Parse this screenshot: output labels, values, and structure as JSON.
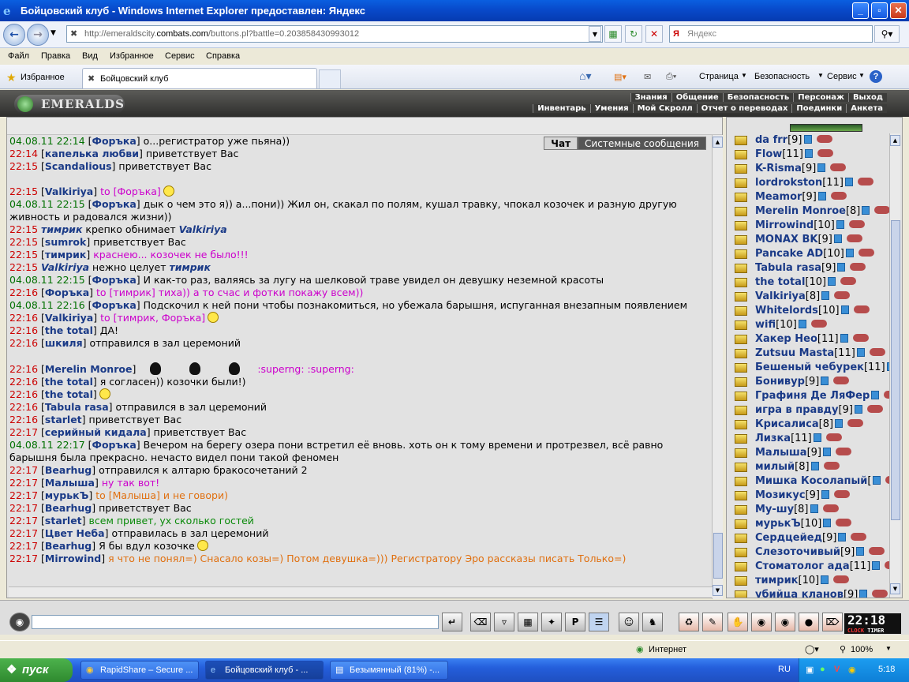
{
  "window": {
    "title": "Бойцовский клуб - Windows Internet Explorer предоставлен: Яндекс",
    "min": "_",
    "max": "▫",
    "close": "✕"
  },
  "nav": {
    "url_prefix": "http://emeraldscity.",
    "url_domain": "combats.com",
    "url_suffix": "/buttons.pl?battle=0.203858430993012",
    "search_placeholder": "Яндекс"
  },
  "menu": [
    "Файл",
    "Правка",
    "Вид",
    "Избранное",
    "Сервис",
    "Справка"
  ],
  "favbar": {
    "favorites": "Избранное",
    "tab": "Бойцовский клуб",
    "tools": [
      "Страница",
      "Безопасность",
      "Сервис"
    ]
  },
  "game": {
    "logo": "EMERALDS",
    "menu_top": [
      "Знания",
      "Общение",
      "Безопасность",
      "Персонаж",
      "Выход"
    ],
    "menu_sub": [
      "Инвентарь",
      "Умения",
      "Мой Скролл",
      "Отчет о переводах",
      "Поединки",
      "Анкета"
    ]
  },
  "chat_tabs": [
    "Чат",
    "Системные сообщения"
  ],
  "chat": [
    {
      "t": "04.08.11 22:14",
      "g": true,
      "n": "Форъка",
      "m": " о...регистратор уже пьяна))"
    },
    {
      "t": "22:14",
      "n": "капелька любви",
      "m": " приветствует Вас"
    },
    {
      "t": "22:15",
      "n": "Scandalious",
      "m": " приветствует Вас"
    },
    {
      "t": "",
      "n": "",
      "m": ""
    },
    {
      "t": "22:15",
      "n": "Valkiriya",
      "to": " to [Форъка]",
      "sm": true
    },
    {
      "t": "04.08.11 22:15",
      "g": true,
      "n": "Форъка",
      "m": " дык о чем это я)) а...пони)) Жил он, скакал по полям, кушал травку, чпокал козочек и разную другую живность и радовался жизни))"
    },
    {
      "t": "22:15",
      "e": "тимрик",
      "m": " крепко обнимает ",
      "e2": "Valkiriya"
    },
    {
      "t": "22:15",
      "n": "sumrok",
      "m": " приветствует Вас"
    },
    {
      "t": "22:15",
      "n": "тимрик",
      "to": " краснею... козочек не было!!!"
    },
    {
      "t": "22:15",
      "e": "Valkiriya",
      "m": " нежно целует ",
      "e2": "тимрик"
    },
    {
      "t": "04.08.11 22:15",
      "g": true,
      "n": "Форъка",
      "m": " И как-то раз, валяясь за лугу на шелковой траве увидел он девушку неземной красоты"
    },
    {
      "t": "22:16",
      "n": "Форъка",
      "to": " to [тимрик] тиха)) а то счас и фотки покажу всем))"
    },
    {
      "t": "04.08.11 22:16",
      "g": true,
      "n": "Форъка",
      "m": " Подскочил к ней пони чтобы познакомиться, но убежала барышня, испуганная внезапным появлением"
    },
    {
      "t": "22:16",
      "n": "Valkiriya",
      "to": " to [тимрик, Форъка]",
      "sm": true
    },
    {
      "t": "22:16",
      "n": "the total",
      "m": " ДА!"
    },
    {
      "t": "22:16",
      "n": "шкиля",
      "m": " отправился в зал церемоний"
    },
    {
      "t": "",
      "n": "",
      "m": ""
    },
    {
      "t": "22:16",
      "n": "Merelin Monroe",
      "balls": true,
      "to": " :superng: :superng:"
    },
    {
      "t": "22:16",
      "n": "the total",
      "m": " я согласен)) козочки были!)"
    },
    {
      "t": "22:16",
      "n": "the total",
      "sm": true
    },
    {
      "t": "22:16",
      "n": "Tabula rasa",
      "m": " отправился в зал церемоний"
    },
    {
      "t": "22:16",
      "n": "starlet",
      "m": " приветствует Вас"
    },
    {
      "t": "22:17",
      "n": "серийный кидала",
      "m": " приветствует Вас"
    },
    {
      "t": "04.08.11 22:17",
      "g": true,
      "n": "Форъка",
      "m": " Вечером на берегу озера пони встретил её вновь. хоть он к тому времени и протрезвел, всё равно барышня была прекрасно. нечасто видел пони такой феномен"
    },
    {
      "t": "22:17",
      "n": "Bearhug",
      "m": " отправился к алтарю бракосочетаний 2"
    },
    {
      "t": "22:17",
      "n": "Малыша",
      "to": " ну так вот!"
    },
    {
      "t": "22:17",
      "n": "мурькЪ",
      "og": " to [Малыша] и не говори)"
    },
    {
      "t": "22:17",
      "n": "Bearhug",
      "m": " приветствует Вас"
    },
    {
      "t": "22:17",
      "n": "starlet",
      "gr": " всем привет, ух сколько гостей"
    },
    {
      "t": "22:17",
      "n": "Цвет Неба",
      "m": " отправилась в зал церемоний"
    },
    {
      "t": "22:17",
      "n": "Bearhug",
      "m": " Я бы вдул козочке",
      "sm": true
    },
    {
      "t": "22:17",
      "n": "Mirrowind",
      "og": " я что не понял=) Снасало козы=) Потом девушка=))) Регистратору Эро рассказы писать Только=)"
    }
  ],
  "users": [
    {
      "n": "da frr",
      "l": "[9]"
    },
    {
      "n": "Flow",
      "l": "[11]"
    },
    {
      "n": "K-Risma",
      "l": "[9]"
    },
    {
      "n": "lordrokston",
      "l": "[11]"
    },
    {
      "n": "Meamor",
      "l": "[9]"
    },
    {
      "n": "Merelin Monroe",
      "l": "[8]"
    },
    {
      "n": "Mirrowind",
      "l": "[10]"
    },
    {
      "n": "MONAX BK",
      "l": "[9]"
    },
    {
      "n": "Pancake AD",
      "l": "[10]"
    },
    {
      "n": "Tabula rasa",
      "l": "[9]"
    },
    {
      "n": "the total",
      "l": "[10]"
    },
    {
      "n": "Valkiriya",
      "l": "[8]"
    },
    {
      "n": "Whitelords",
      "l": "[10]"
    },
    {
      "n": "wifi",
      "l": "[10]"
    },
    {
      "n": "Хакер Нео",
      "l": "[11]"
    },
    {
      "n": "Zutsuu Masta",
      "l": "[11]"
    },
    {
      "n": "Бешеный чебурек",
      "l": "[11]"
    },
    {
      "n": "Бонивур",
      "l": "[9]"
    },
    {
      "n": "Графиня Де ЛяФер",
      "l": ""
    },
    {
      "n": "игра в правду",
      "l": "[9]"
    },
    {
      "n": "Крисалиса",
      "l": "[8]"
    },
    {
      "n": "Лизка",
      "l": "[11]"
    },
    {
      "n": "Малыша",
      "l": "[9]"
    },
    {
      "n": "милый",
      "l": "[8]"
    },
    {
      "n": "Мишка Косолапый",
      "l": "["
    },
    {
      "n": "Мозикус",
      "l": "[9]"
    },
    {
      "n": "Му-шу",
      "l": "[8]"
    },
    {
      "n": "мурькЪ",
      "l": "[10]"
    },
    {
      "n": "Сердцейед",
      "l": "[9]"
    },
    {
      "n": "Слезоточивый",
      "l": "[9]"
    },
    {
      "n": "Стоматолог ада",
      "l": "[11]"
    },
    {
      "n": "тимрик",
      "l": "[10]"
    },
    {
      "n": "убийца кланов",
      "l": "[9]"
    }
  ],
  "clock": {
    "time": "22:18",
    "label1": "CLOCK",
    "label2": "TIMER"
  },
  "status": {
    "zone": "Интернет",
    "zoom": "100%"
  },
  "taskbar": {
    "start": "пуск",
    "items": [
      "RapidShare – Secure ...",
      "Бойцовский клуб - ...",
      "Безымянный (81%) -..."
    ],
    "lang": "RU",
    "time": "5:18"
  },
  "colors": {
    "titlebar": "#0848c8",
    "chat_bg": "#e2e2e2",
    "nick": "#1a3a87",
    "time": "#cc0000",
    "private": "#cc00cc"
  }
}
